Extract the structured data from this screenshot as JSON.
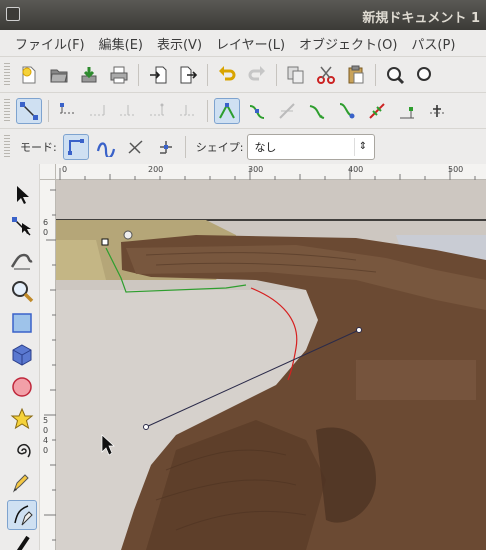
{
  "window": {
    "title": "新規ドキュメント 1"
  },
  "menubar": {
    "items": [
      "ファイル(F)",
      "編集(E)",
      "表示(V)",
      "レイヤー(L)",
      "オブジェクト(O)",
      "パス(P)"
    ]
  },
  "toolbar_main": {
    "icons": [
      "new-document-icon",
      "open-icon",
      "import-icon",
      "print-icon",
      "import-arrow-icon",
      "export-icon",
      "undo-icon",
      "redo-icon",
      "duplicate-icon",
      "cut-icon",
      "paste-icon",
      "zoom-icon"
    ]
  },
  "toolbar_node": {
    "icons": [
      "node-select-icon",
      "insert-node-icon",
      "delete-node-icon",
      "join-nodes-icon",
      "break-path-icon",
      "join-segment-icon",
      "make-cusp-icon",
      "make-smooth-icon",
      "make-symmetric-icon",
      "make-auto-icon",
      "segment-line-icon",
      "segment-curve-icon",
      "object-to-path-icon",
      "stroke-to-path-icon"
    ]
  },
  "tool_controls": {
    "mode_label": "モード:",
    "shape_label": "シェイプ:",
    "shape_value": "なし"
  },
  "rulers": {
    "h_ticks": [
      "0",
      "200",
      "300",
      "400",
      "500"
    ],
    "v_ticks": [
      "6",
      "0",
      "5",
      "0",
      "4",
      "0"
    ]
  },
  "colors": {
    "titlebar": "#3c3b37",
    "accent": "#e0701a",
    "selection": "#7ea3cf",
    "guide": "#2e9e2e",
    "curve": "#d62020"
  },
  "toolbox": {
    "icons": [
      "selector-icon",
      "node-editor-icon",
      "tweak-icon",
      "zoom-tool-icon",
      "rectangle-icon",
      "3d-box-icon",
      "ellipse-icon",
      "star-icon",
      "spiral-icon",
      "pencil-icon",
      "pen-icon",
      "calligraphy-icon"
    ]
  }
}
